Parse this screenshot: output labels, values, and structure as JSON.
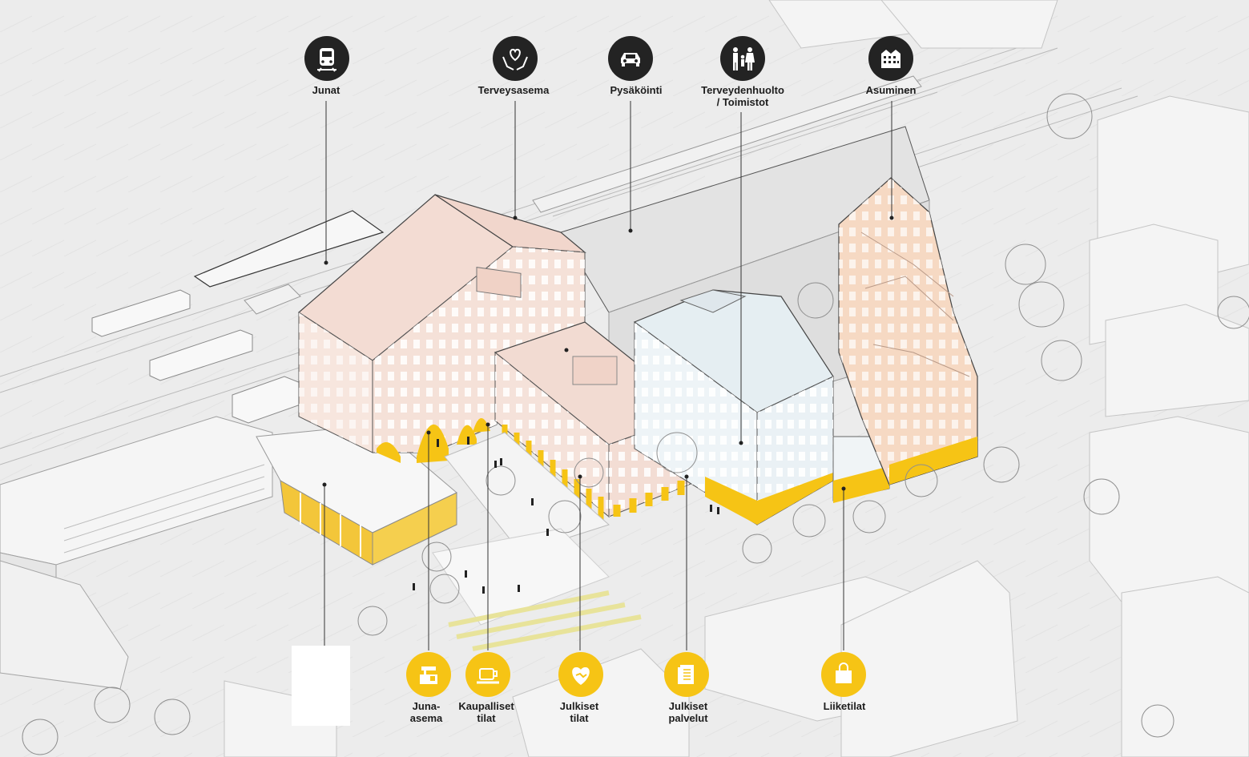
{
  "colors": {
    "background": "#ececec",
    "building_pink": "#f6e0d7",
    "building_peach": "#f6d9c3",
    "building_blue": "#eaf2f6",
    "accent_yellow": "#f6c415",
    "icon_dark": "#232323"
  },
  "top_categories": [
    {
      "id": "junat",
      "label": "Junat",
      "icon": "train-icon"
    },
    {
      "id": "terveysasema",
      "label": "Terveysasema",
      "icon": "heart-hands-icon"
    },
    {
      "id": "pysakointi",
      "label": "Pysäköinti",
      "icon": "car-icon"
    },
    {
      "id": "terveydenhuolto",
      "label": "Terveydenhuolto\n/ Toimistot",
      "icon": "people-icon"
    },
    {
      "id": "asuminen",
      "label": "Asuminen",
      "icon": "apartment-building-icon"
    }
  ],
  "bottom_categories": [
    {
      "id": "junaasema",
      "label": "Juna-\nasema",
      "icon": "ticket-kiosk-icon"
    },
    {
      "id": "kaupalliset",
      "label": "Kaupalliset\ntilat",
      "icon": "coffee-cup-icon"
    },
    {
      "id": "julkisettilat",
      "label": "Julkiset\ntilat",
      "icon": "heart-handshake-icon"
    },
    {
      "id": "julkisetpalvelut",
      "label": "Julkiset\npalvelut",
      "icon": "document-checklist-icon"
    },
    {
      "id": "liiketilat",
      "label": "Liiketilat",
      "icon": "shopping-bag-icon"
    }
  ]
}
